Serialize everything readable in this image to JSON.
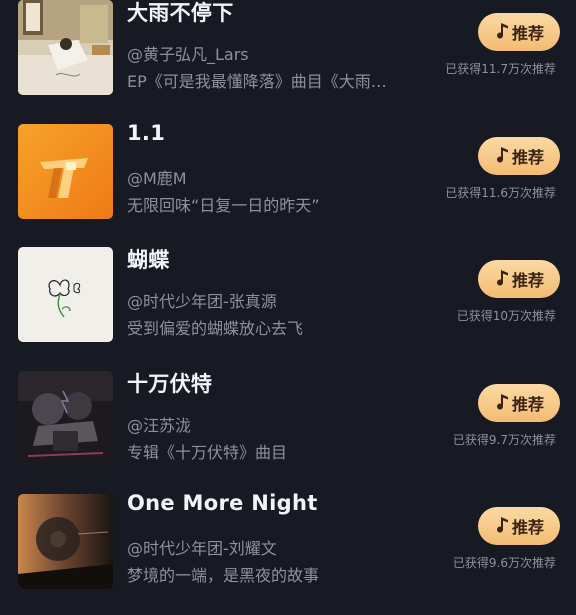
{
  "songs": [
    {
      "title": "大雨不停下",
      "artist": "@黄子弘凡_Lars",
      "desc": "EP《可是我最懂降落》曲目《大雨…",
      "button": "推荐",
      "count": "已获得11.7万次推荐",
      "cover": "rain-cover"
    },
    {
      "title": "1.1",
      "artist": "@M鹿M",
      "desc": "无限回味“日复一日的昨天”",
      "button": "推荐",
      "count": "已获得11.6万次推荐",
      "cover": "orange-cover"
    },
    {
      "title": "蝴蝶",
      "artist": "@时代少年团-张真源",
      "desc": "受到偏爱的蝴蝶放心去飞",
      "button": "推荐",
      "count": "已获得10万次推荐",
      "cover": "butterfly-cover"
    },
    {
      "title": "十万伏特",
      "artist": "@汪苏泷",
      "desc": "专辑《十万伏特》曲目",
      "button": "推荐",
      "count": "已获得9.7万次推荐",
      "cover": "volt-cover"
    },
    {
      "title": "One More Night",
      "artist": "@时代少年团-刘耀文",
      "desc": "梦境的一端，是黑夜的故事",
      "button": "推荐",
      "count": "已获得9.6万次推荐",
      "cover": "night-cover"
    }
  ],
  "colors": {
    "background": "#171a22",
    "button_gradient_start": "#fbd9a3",
    "button_gradient_end": "#f2bc72",
    "button_text": "#3a2410",
    "muted_text": "#8d919b"
  }
}
